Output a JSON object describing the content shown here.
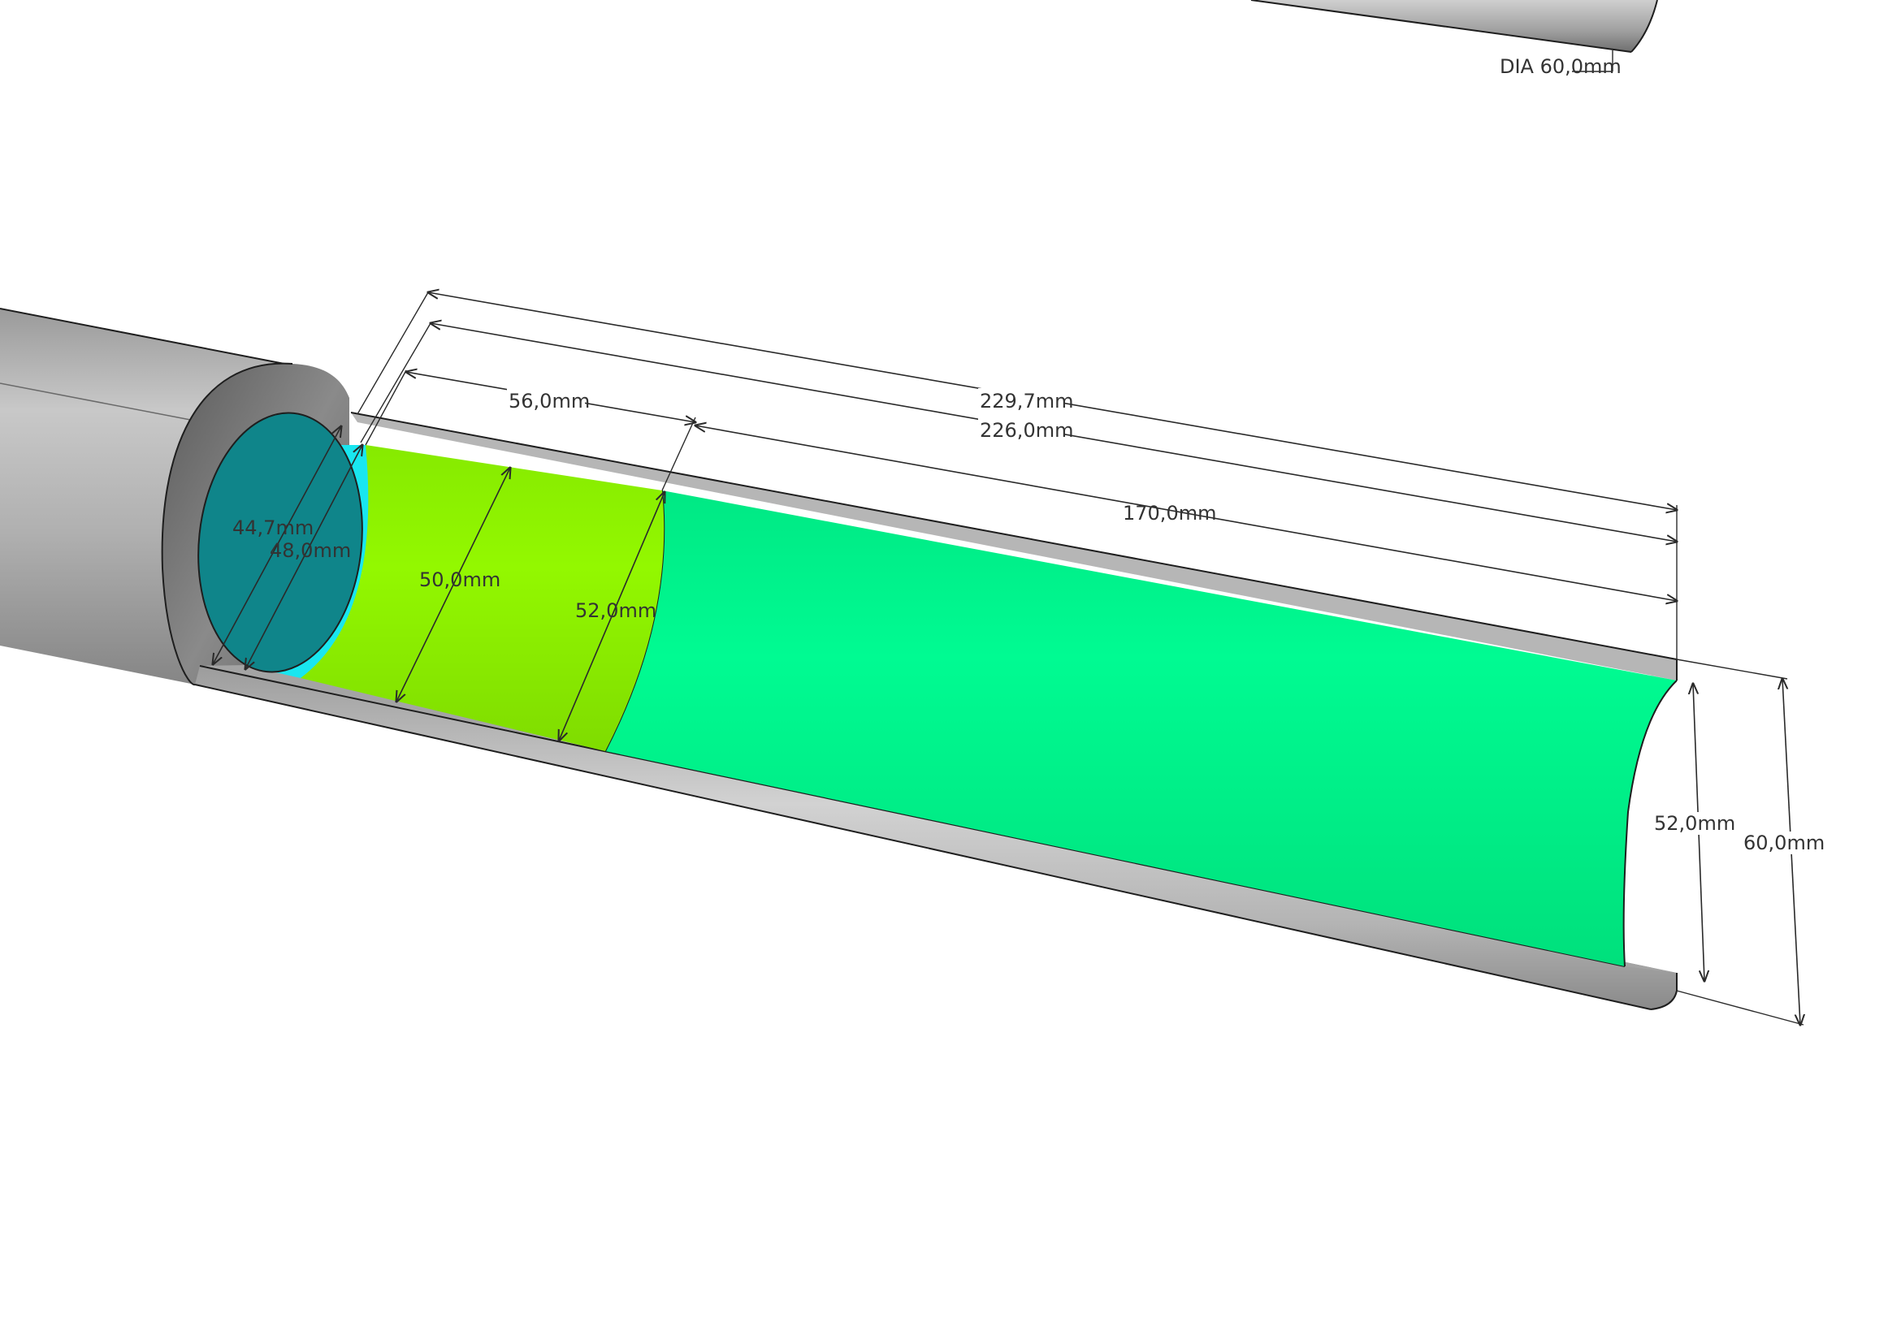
{
  "drawing": {
    "top_right_label": "DIA 60,0mm",
    "dimensions": {
      "overall_length_a": "229,7mm",
      "overall_length_b": "226,0mm",
      "segment_length": "56,0mm",
      "remaining_length": "170,0mm",
      "inner_diameter_small": "44,7mm",
      "inner_diameter_medium": "48,0mm",
      "green_diameter_a": "50,0mm",
      "green_diameter_b": "52,0mm",
      "end_inner_diameter": "52,0mm",
      "outer_diameter": "60,0mm"
    },
    "colors": {
      "background": "#ffffff",
      "tube_grey": "#b8b8b8",
      "tube_dark": "#6a6a6a",
      "bore_teal": "#0f858a",
      "ring_cyan": "#19e6f0",
      "section_lime": "#8ef200",
      "section_green": "#00f58a",
      "dimension_line": "#2a2a2a"
    }
  }
}
